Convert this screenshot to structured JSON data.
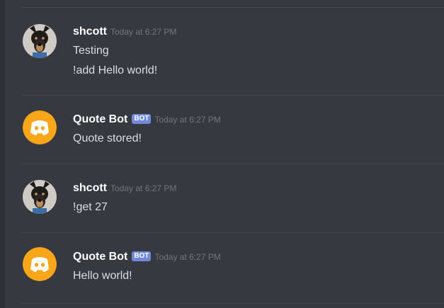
{
  "colors": {
    "background": "#36393f",
    "bot_badge": "#7289da",
    "bot_avatar": "#faa61a"
  },
  "messages": [
    {
      "username": "shcott",
      "avatar": "dog-avatar-icon",
      "timestamp": "Today at 6:27 PM",
      "lines": [
        "Testing",
        "!add Hello world!"
      ]
    },
    {
      "username": "Quote Bot",
      "badge": "BOT",
      "avatar": "discord-logo-icon",
      "timestamp": "Today at 6:27 PM",
      "lines": [
        "Quote stored!"
      ]
    },
    {
      "username": "shcott",
      "avatar": "dog-avatar-icon",
      "timestamp": "Today at 6:27 PM",
      "lines": [
        "!get 27"
      ]
    },
    {
      "username": "Quote Bot",
      "badge": "BOT",
      "avatar": "discord-logo-icon",
      "timestamp": "Today at 6:27 PM",
      "lines": [
        "Hello world!"
      ]
    }
  ]
}
